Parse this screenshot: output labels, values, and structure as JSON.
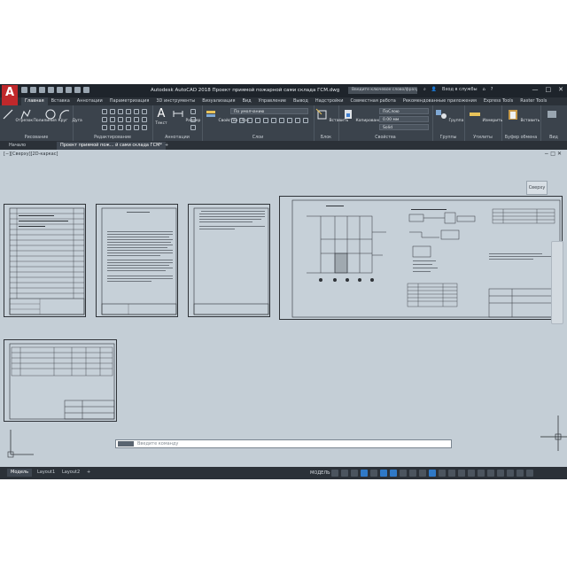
{
  "window": {
    "title": "Autodesk AutoCAD 2018   Проект приямой пожарной сами склада ГСМ.dwg",
    "search_placeholder": "Введите ключевое слово/фразу",
    "user": "Вход в службы",
    "logo": "A",
    "buttons": [
      "—",
      "□",
      "✕"
    ]
  },
  "ribbon": {
    "tabs": [
      "Главная",
      "Вставка",
      "Аннотации",
      "Параметризация",
      "3D инструменты",
      "Визуализация",
      "Вид",
      "Управление",
      "Вывод",
      "Надстройки",
      "Совместная работа",
      "Рекомендованные приложения",
      "Express Tools",
      "Raster Tools"
    ],
    "active_tab": "Главная",
    "panels": {
      "draw": {
        "label": "Рисование",
        "tools": [
          "Отрезок",
          "Полилиния",
          "Круг",
          "Дуга"
        ]
      },
      "modify": {
        "label": "Редактирование"
      },
      "annotation": {
        "label": "Аннотации",
        "tools": [
          "Текст",
          "Размер"
        ]
      },
      "block": {
        "label": "Блок",
        "tools": [
          "Вставить"
        ]
      },
      "layers": {
        "label": "Слои",
        "tool": "Свойства слоя",
        "layer_value": "По умолчанию"
      },
      "properties": {
        "label": "Свойства",
        "tool": "Копирование свойств",
        "color": "ПоСлою",
        "lineweight": "0.00 мм",
        "linetype": "Solid"
      },
      "groups": {
        "label": "Группы",
        "tool": "Группа"
      },
      "utilities": {
        "label": "Утилиты",
        "tool": "Измерить"
      },
      "clipboard": {
        "label": "Буфер обмена",
        "tool": "Вставить"
      },
      "view": {
        "label": "Вид"
      }
    }
  },
  "file_tabs": [
    "Начало",
    "Проект приямой пож... й сами склада ГСМ*"
  ],
  "viewport": {
    "label": "[−][Сверху][2D-каркас]",
    "viewcube_label": "Сверху",
    "command_placeholder": "Введите команду"
  },
  "status": {
    "layout_tabs": [
      "Модель",
      "Layout1",
      "Layout2"
    ],
    "active_layout": "Модель",
    "mode": "МОДЕЛЬ"
  }
}
